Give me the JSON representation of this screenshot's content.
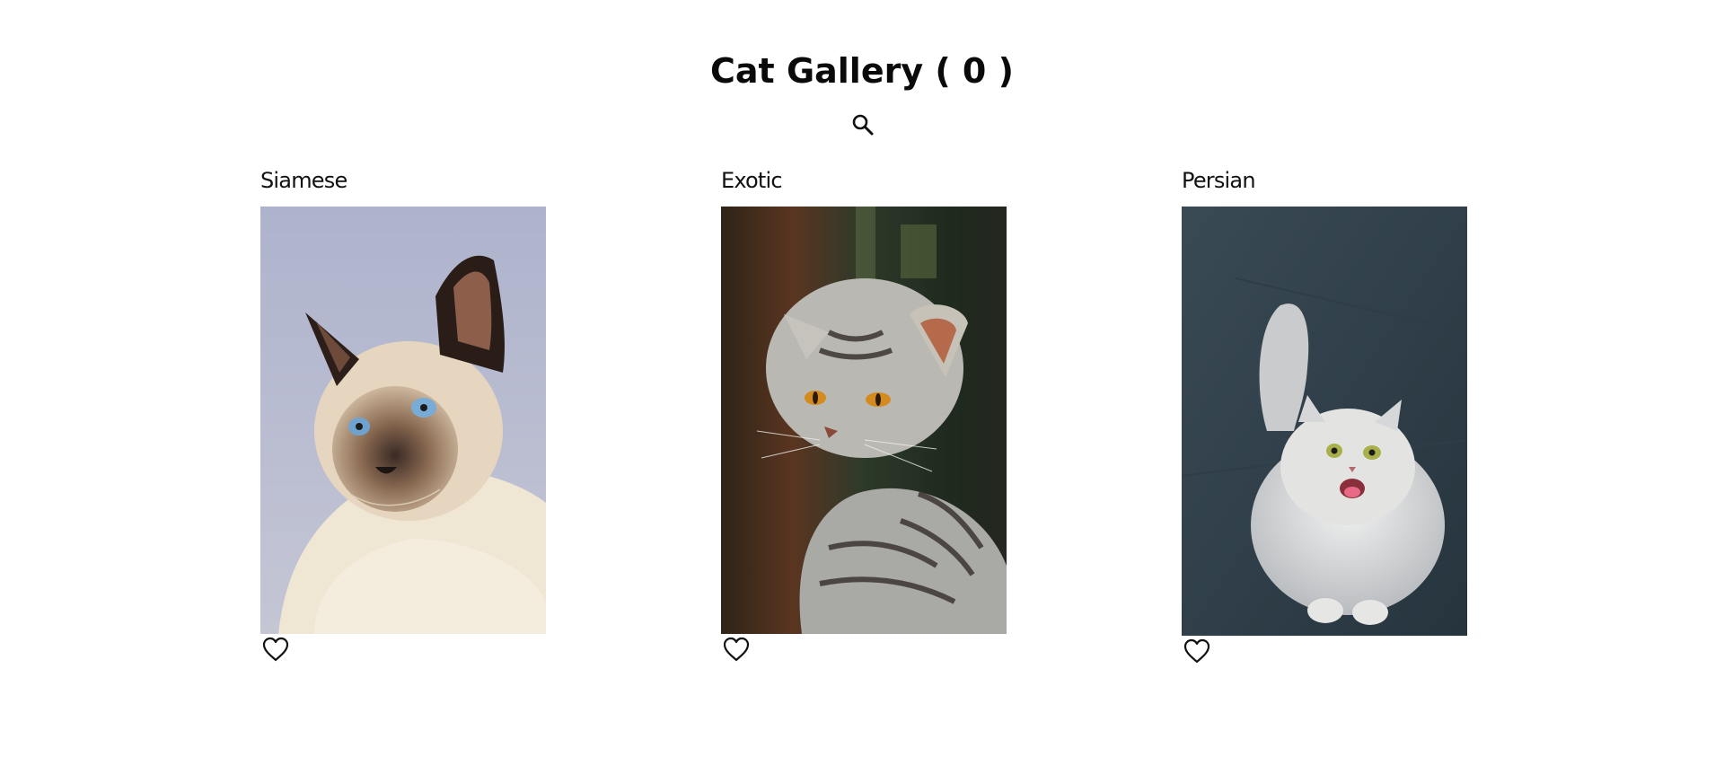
{
  "page": {
    "title": "Cat Gallery ( 0 )",
    "search_icon": "search-icon"
  },
  "cats": [
    {
      "name": "Siamese",
      "photo": "siamese-cat-photo",
      "like_icon": "heart-outline-icon"
    },
    {
      "name": "Exotic",
      "photo": "exotic-cat-photo",
      "like_icon": "heart-outline-icon"
    },
    {
      "name": "Persian",
      "photo": "persian-cat-photo",
      "like_icon": "heart-outline-icon"
    }
  ],
  "colors": {
    "text": "#0a0a0a",
    "background": "#ffffff"
  }
}
